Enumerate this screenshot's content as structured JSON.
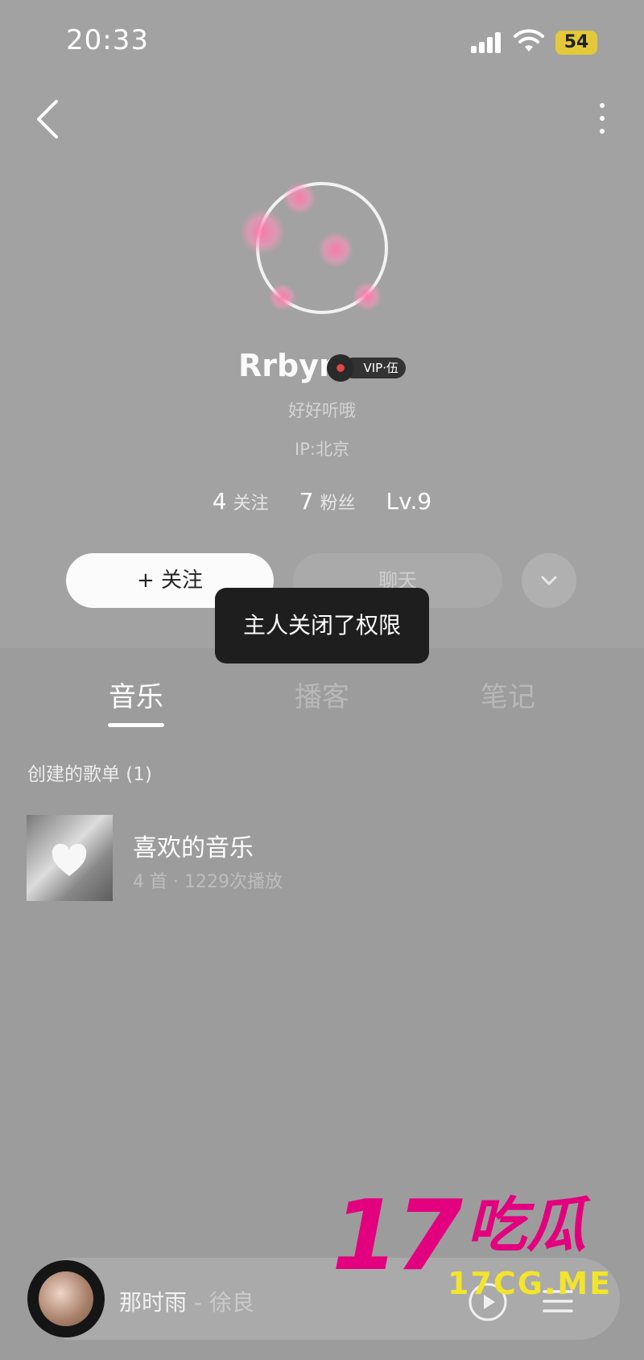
{
  "status_bar": {
    "time": "20:33",
    "battery": "54"
  },
  "profile": {
    "username": "Rrbyr",
    "vip_label": "VIP·伍",
    "signature": "好好听哦",
    "ip_location": "IP:北京",
    "stats": {
      "following_count": "4",
      "following_label": "关注",
      "followers_count": "7",
      "followers_label": "粉丝",
      "level": "Lv.9"
    },
    "follow_button": "+ 关注",
    "chat_button": "聊天"
  },
  "toast": "主人关闭了权限",
  "tabs": [
    {
      "label": "音乐",
      "active": true
    },
    {
      "label": "播客",
      "active": false
    },
    {
      "label": "笔记",
      "active": false
    }
  ],
  "music_section": {
    "title": "创建的歌单 (1)",
    "playlists": [
      {
        "name": "喜欢的音乐",
        "meta": "4 首 · 1229次播放"
      }
    ]
  },
  "mini_player": {
    "song_title": "那时雨",
    "separator": " - ",
    "artist": "徐良"
  },
  "watermark": {
    "number": "17",
    "chars": "吃瓜",
    "url": "17CG.ME"
  },
  "colors": {
    "accent_watermark": "#e3007f",
    "watermark_url": "#f3e42c",
    "battery": "#e3c83a"
  },
  "icons": [
    "back-icon",
    "more-icon",
    "chevron-down-icon",
    "play-icon",
    "playlist-icon",
    "signal-icon",
    "wifi-icon",
    "battery-icon"
  ]
}
